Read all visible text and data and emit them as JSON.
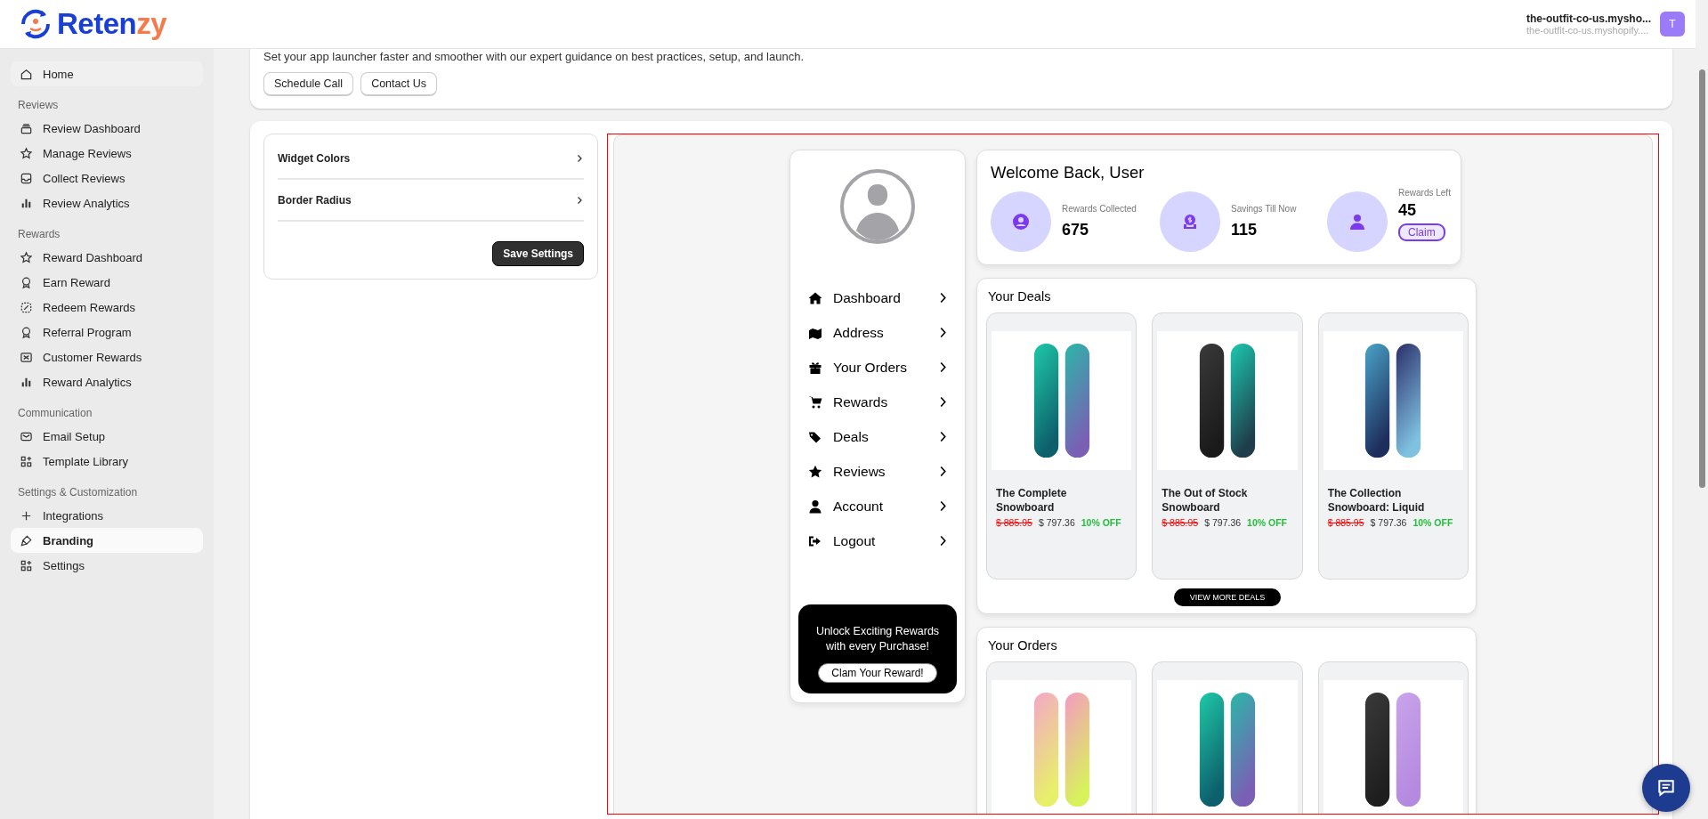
{
  "header": {
    "logo_main": "Reten",
    "logo_accent": "zy",
    "store_name": "the-outfit-co-us.mysho...",
    "store_domain": "the-outfit-co-us.myshopify....",
    "avatar": "T"
  },
  "sidebar": {
    "items": [
      {
        "kind": "item",
        "label": "Home",
        "selected": false
      },
      {
        "kind": "heading",
        "label": "Reviews"
      },
      {
        "kind": "item",
        "label": "Review Dashboard",
        "selected": false
      },
      {
        "kind": "item",
        "label": "Manage Reviews",
        "selected": false
      },
      {
        "kind": "item",
        "label": "Collect Reviews",
        "selected": false
      },
      {
        "kind": "item",
        "label": "Review Analytics",
        "selected": false
      },
      {
        "kind": "heading",
        "label": "Rewards"
      },
      {
        "kind": "item",
        "label": "Reward Dashboard",
        "selected": false
      },
      {
        "kind": "item",
        "label": "Earn Reward",
        "selected": false
      },
      {
        "kind": "item",
        "label": "Redeem Rewards",
        "selected": false
      },
      {
        "kind": "item",
        "label": "Referral Program",
        "selected": false
      },
      {
        "kind": "item",
        "label": "Customer Rewards",
        "selected": false
      },
      {
        "kind": "item",
        "label": "Reward Analytics",
        "selected": false
      },
      {
        "kind": "heading",
        "label": "Communication"
      },
      {
        "kind": "item",
        "label": "Email Setup",
        "selected": false
      },
      {
        "kind": "item",
        "label": "Template Library",
        "selected": false
      },
      {
        "kind": "heading",
        "label": "Settings & Customization"
      },
      {
        "kind": "item",
        "label": "Integrations",
        "selected": false
      },
      {
        "kind": "item",
        "label": "Branding",
        "selected": true
      },
      {
        "kind": "item",
        "label": "Settings",
        "selected": false
      }
    ]
  },
  "guidance": {
    "text": "Set your app launcher faster and smoother with our expert guidance on best practices, setup, and launch.",
    "buttons": [
      "Schedule Call",
      "Contact Us"
    ]
  },
  "settings": {
    "rows": [
      "Widget Colors",
      "Border Radius"
    ],
    "save_button": "Save Settings"
  },
  "preview": {
    "menu": [
      "Dashboard",
      "Address",
      "Your Orders",
      "Rewards",
      "Deals",
      "Reviews",
      "Account",
      "Logout"
    ],
    "promo": {
      "text": "Unlock Exciting Rewards with every Purchase!",
      "button": "Clam Your Reward!"
    },
    "welcome": {
      "title": "Welcome Back, User",
      "stats": [
        {
          "label": "Rewards Collected",
          "value": "675"
        },
        {
          "label": "Savings Till Now",
          "value": "115"
        },
        {
          "label": "Rewards Left",
          "value": "45",
          "action": "Claim"
        }
      ]
    },
    "deals": {
      "title": "Your Deals",
      "button": "VIEW MORE DEALS",
      "items": [
        {
          "kind": "teal",
          "name": "The Complete Snowboard",
          "old_price": "$ 885.95",
          "price": "$ 797.36",
          "discount": "10% OFF"
        },
        {
          "kind": "dark",
          "name": "The Out of Stock Snowboard",
          "old_price": "$ 885.95",
          "price": "$ 797.36",
          "discount": "10% OFF"
        },
        {
          "kind": "navy",
          "name": "The Collection Snowboard: Liquid",
          "old_price": "$ 885.95",
          "price": "$ 797.36",
          "discount": "10% OFF"
        }
      ]
    },
    "orders": {
      "title": "Your Orders",
      "items": [
        {
          "kind": "pastel"
        },
        {
          "kind": "teal"
        },
        {
          "kind": "lilac"
        }
      ]
    }
  }
}
